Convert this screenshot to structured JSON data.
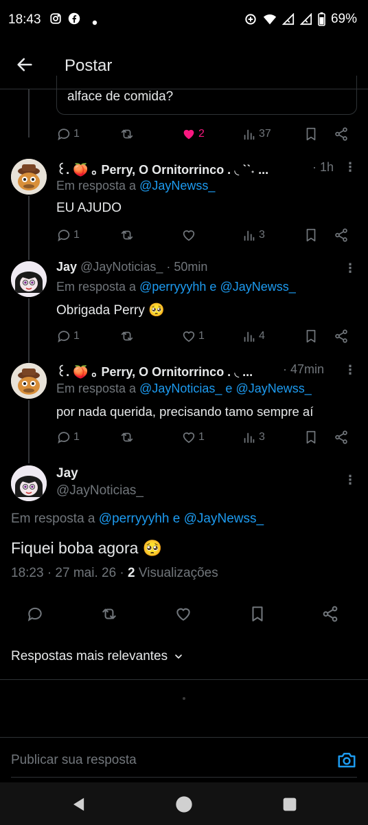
{
  "status_bar": {
    "time": "18:43",
    "battery": "69%"
  },
  "header": {
    "title": "Postar"
  },
  "quoted_tweet": {
    "text": "alface de comida?",
    "reply_count": "1",
    "like_count": "2",
    "view_count": "37"
  },
  "replies": [
    {
      "name": "꒰. 🍑 ｡ Perry, O Ornitorrinco . ◟ ˋˋ˖ ...",
      "handle": "",
      "time": "· 1h",
      "reply_to_prefix": "Em resposta a",
      "mention_1": "@JayNewss_",
      "mention_sep": "",
      "mention_2": "",
      "text": "EU AJUDO",
      "reply_count": "1",
      "like_count": "",
      "view_count": "3"
    },
    {
      "name": "Jay",
      "handle": "@JayNoticias_",
      "time": "· 50min",
      "reply_to_prefix": "Em resposta a",
      "mention_1": "@perryyyhh",
      "mention_sep": "e",
      "mention_2": "@JayNewss_",
      "text": "Obrigada Perry 🥺",
      "reply_count": "1",
      "like_count": "1",
      "view_count": "4"
    },
    {
      "name": "꒰. 🍑 ｡ Perry, O Ornitorrinco . ◟ ...",
      "handle": "",
      "time": "· 47min",
      "reply_to_prefix": "Em resposta a",
      "mention_1": "@JayNoticias_",
      "mention_sep": "e",
      "mention_2": "@JayNewss_",
      "text": "por nada querida, precisando tamo sempre aí",
      "reply_count": "1",
      "like_count": "1",
      "view_count": "3"
    }
  ],
  "main_tweet": {
    "name": "Jay",
    "handle": "@JayNoticias_",
    "reply_to_prefix": "Em resposta a",
    "mention_1": "@perryyyhh",
    "mention_sep": "e",
    "mention_2": "@JayNewss_",
    "text": "Fiquei boba agora 🥺",
    "timestamp": "18:23 · 27 mai. 26 ·",
    "views_count": "2",
    "views_label": "Visualizações"
  },
  "sort": {
    "label": "Respostas mais relevantes"
  },
  "composer": {
    "placeholder": "Publicar sua resposta"
  },
  "colors": {
    "accent": "#1d9bf0",
    "like": "#f91880",
    "muted": "#71767b",
    "bg": "#000000"
  }
}
